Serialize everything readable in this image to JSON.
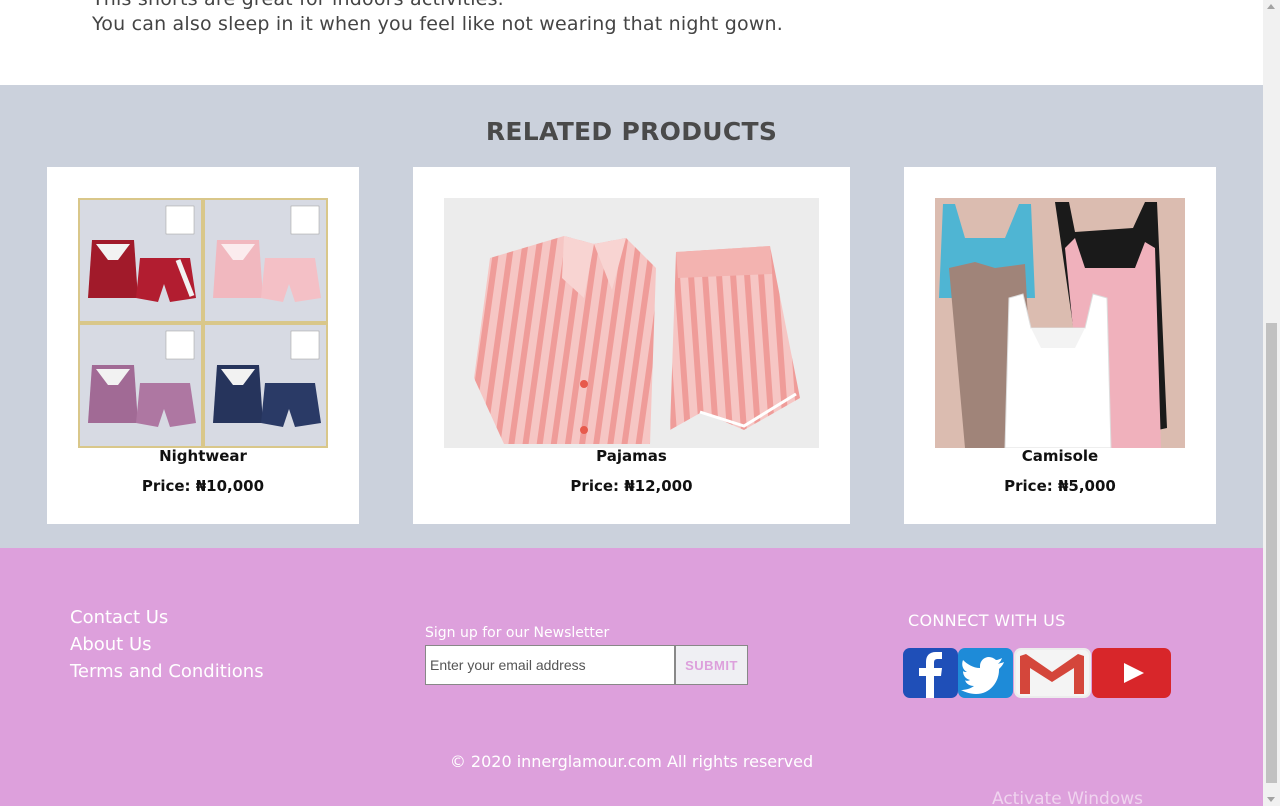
{
  "description": {
    "line1": "This shorts are great for indoors activities.",
    "line2": "You can also sleep in it when you feel like not wearing that night gown."
  },
  "related": {
    "heading": "RELATED PRODUCTS",
    "products": [
      {
        "name": "Nightwear",
        "price": "Price: ₦10,000"
      },
      {
        "name": "Pajamas",
        "price": "Price: ₦12,000"
      },
      {
        "name": "Camisole",
        "price": "Price: ₦5,000"
      }
    ]
  },
  "footer": {
    "links": [
      "Contact Us",
      "About Us",
      "Terms and Conditions"
    ],
    "newsletter": {
      "label": "Sign up for our Newsletter",
      "placeholder": "Enter your email address",
      "submit": "SUBMIT"
    },
    "connect": "CONNECT WITH US",
    "social": [
      {
        "icon": "facebook-icon",
        "color": "#1f4fb8"
      },
      {
        "icon": "twitter-icon",
        "color": "#1e8bd8"
      },
      {
        "icon": "gmail-icon",
        "color": "#c8372d"
      },
      {
        "icon": "youtube-icon",
        "color": "#d8262a"
      }
    ],
    "copyright": "© 2020 innerglamour.com All rights reserved"
  },
  "colors": {
    "related_bg": "#cbd1dc",
    "footer_bg": "#dda0dc",
    "card_bg": "#ffffff"
  },
  "os_watermark": "Activate Windows"
}
